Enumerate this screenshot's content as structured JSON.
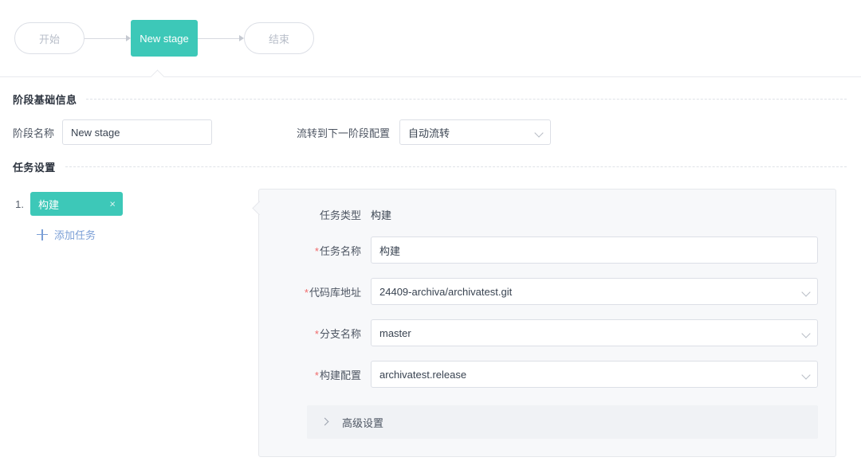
{
  "flow": {
    "start_node": "开始",
    "stage_node": "New stage",
    "end_node": "结束",
    "stage_color": "#3dc8b8"
  },
  "basic_section": {
    "title": "阶段基础信息",
    "stage_name_label": "阶段名称",
    "stage_name_value": "New stage",
    "flow_label": "流转到下一阶段配置",
    "flow_value": "自动流转"
  },
  "task_section": {
    "title": "任务设置",
    "tasks": [
      {
        "index": "1.",
        "name": "构建",
        "close": "×"
      }
    ],
    "add_task_label": "添加任务"
  },
  "detail": {
    "type_label": "任务类型",
    "type_value": "构建",
    "required_mark": "*",
    "fields": [
      {
        "label": "任务名称",
        "value": "构建",
        "control": "input"
      },
      {
        "label": "代码库地址",
        "value": "24409-archiva/archivatest.git",
        "control": "select"
      },
      {
        "label": "分支名称",
        "value": "master",
        "control": "select"
      },
      {
        "label": "构建配置",
        "value": "archivatest.release",
        "control": "select"
      }
    ],
    "advanced_label": "高级设置"
  }
}
